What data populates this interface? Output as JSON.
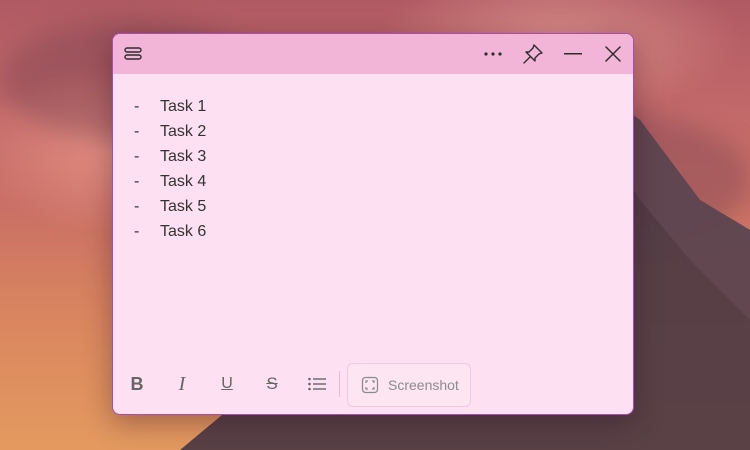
{
  "titlebar": {
    "menu_icon": "menu-icon",
    "more_icon": "more-icon",
    "pin_icon": "pin-icon",
    "minimize_icon": "minimize-icon",
    "close_icon": "close-icon"
  },
  "note": {
    "items": [
      {
        "bullet": "-",
        "text": "Task 1"
      },
      {
        "bullet": "-",
        "text": "Task 2"
      },
      {
        "bullet": "-",
        "text": "Task 3"
      },
      {
        "bullet": "-",
        "text": "Task 4"
      },
      {
        "bullet": "-",
        "text": "Task 5"
      },
      {
        "bullet": "-",
        "text": "Task 6"
      }
    ]
  },
  "toolbar": {
    "bold_icon": "bold-icon",
    "italic_icon": "italic-icon",
    "underline_icon": "underline-icon",
    "strikethrough_icon": "strikethrough-icon",
    "list_icon": "bullet-list-icon",
    "screenshot_label": "Screenshot",
    "screenshot_icon": "screenshot-icon"
  },
  "colors": {
    "note_bg": "#fde0f1",
    "titlebar_bg": "#f2b5d8",
    "border": "#a64fb0"
  }
}
